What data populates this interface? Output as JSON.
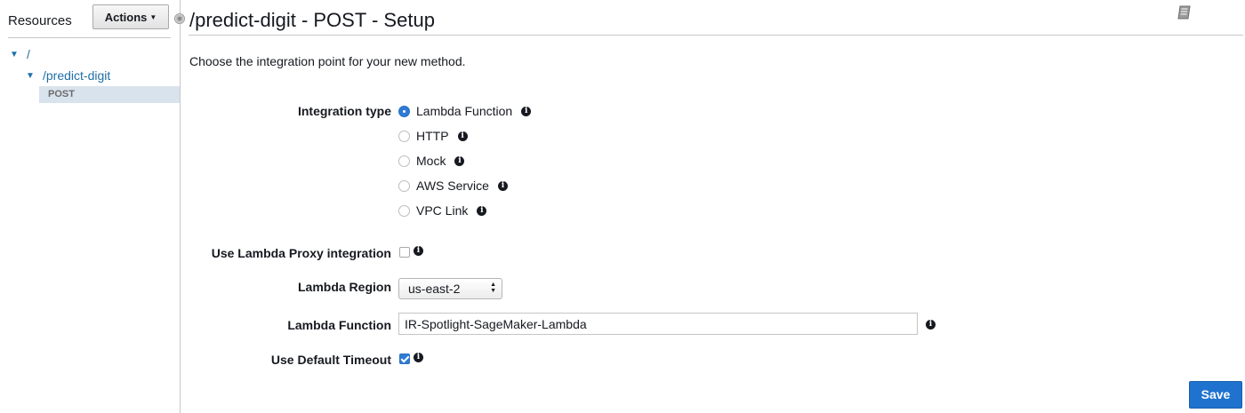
{
  "sidebar": {
    "title": "Resources",
    "actions_label": "Actions",
    "tree": {
      "root": "/",
      "resource": "/predict-digit",
      "method": "POST"
    }
  },
  "header": {
    "title": "/predict-digit - POST - Setup"
  },
  "main": {
    "intro": "Choose the integration point for your new method.",
    "integration_type": {
      "label": "Integration type",
      "selected": "Lambda Function",
      "options": [
        "Lambda Function",
        "HTTP",
        "Mock",
        "AWS Service",
        "VPC Link"
      ]
    },
    "proxy": {
      "label": "Use Lambda Proxy integration",
      "checked": false
    },
    "region": {
      "label": "Lambda Region",
      "value": "us-east-2"
    },
    "function": {
      "label": "Lambda Function",
      "value": "IR-Spotlight-SageMaker-Lambda"
    },
    "timeout": {
      "label": "Use Default Timeout",
      "checked": true
    },
    "save_label": "Save"
  },
  "icons": {
    "info": "info-icon",
    "docs": "book-icon",
    "tree_expand": "caret-down-icon"
  },
  "colors": {
    "accent": "#1f73cf",
    "link": "#1f6fa8",
    "selected_row": "#d9e3ee"
  }
}
